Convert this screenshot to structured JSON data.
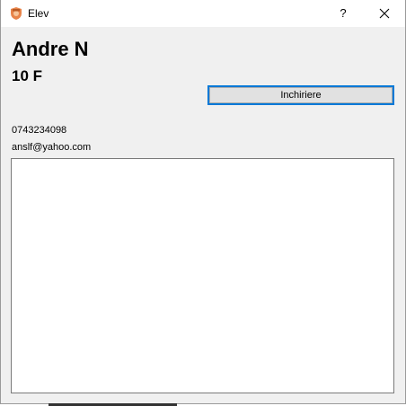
{
  "window": {
    "title": "Elev",
    "help_label": "?",
    "icon": "student-app-icon",
    "accent_color": "#0078d7"
  },
  "student": {
    "name": "Andre N",
    "class": "10 F",
    "phone": "0743234098",
    "email": "anslf@yahoo.com"
  },
  "actions": {
    "close_label": "Inchiriere"
  },
  "notes": {
    "content": ""
  }
}
